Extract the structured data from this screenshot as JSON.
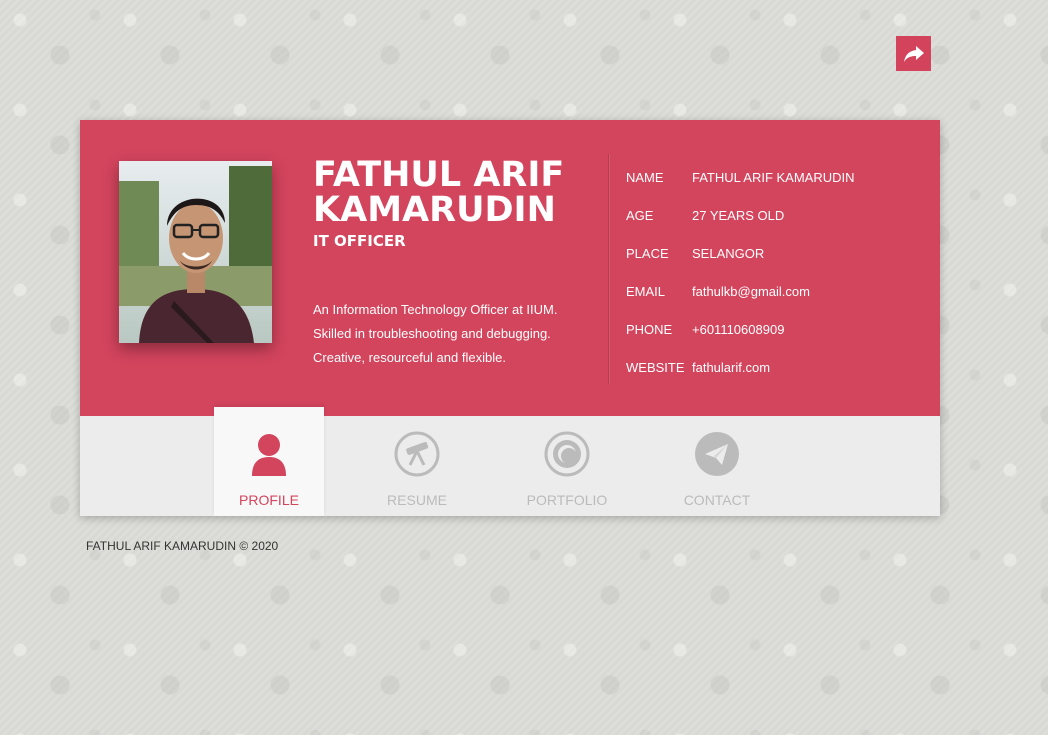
{
  "header": {
    "share_icon": "share-icon"
  },
  "profile": {
    "name": "FATHUL ARIF KAMARUDIN",
    "role": "IT OFFICER",
    "bio": "An Information Technology Officer at IIUM. Skilled in troubleshooting and debugging. Creative, resourceful and flexible.",
    "details": [
      {
        "label": "NAME",
        "value": "FATHUL ARIF KAMARUDIN"
      },
      {
        "label": "AGE",
        "value": "27 YEARS OLD"
      },
      {
        "label": "PLACE",
        "value": "SELANGOR"
      },
      {
        "label": "EMAIL",
        "value": "fathulkb@gmail.com"
      },
      {
        "label": "PHONE",
        "value": "+601110608909"
      },
      {
        "label": "WEBSITE",
        "value": "fathularif.com"
      }
    ]
  },
  "nav": {
    "active": "PROFILE",
    "items": [
      {
        "label": "PROFILE",
        "icon": "user-icon"
      },
      {
        "label": "RESUME",
        "icon": "telescope-icon"
      },
      {
        "label": "PORTFOLIO",
        "icon": "camera-lens-icon"
      },
      {
        "label": "CONTACT",
        "icon": "paper-plane-icon"
      }
    ]
  },
  "footer": {
    "text": "FATHUL ARIF KAMARUDIN © 2020"
  },
  "colors": {
    "accent": "#d3445d",
    "nav_bg": "#ececec",
    "inactive": "#bbbbbb"
  }
}
